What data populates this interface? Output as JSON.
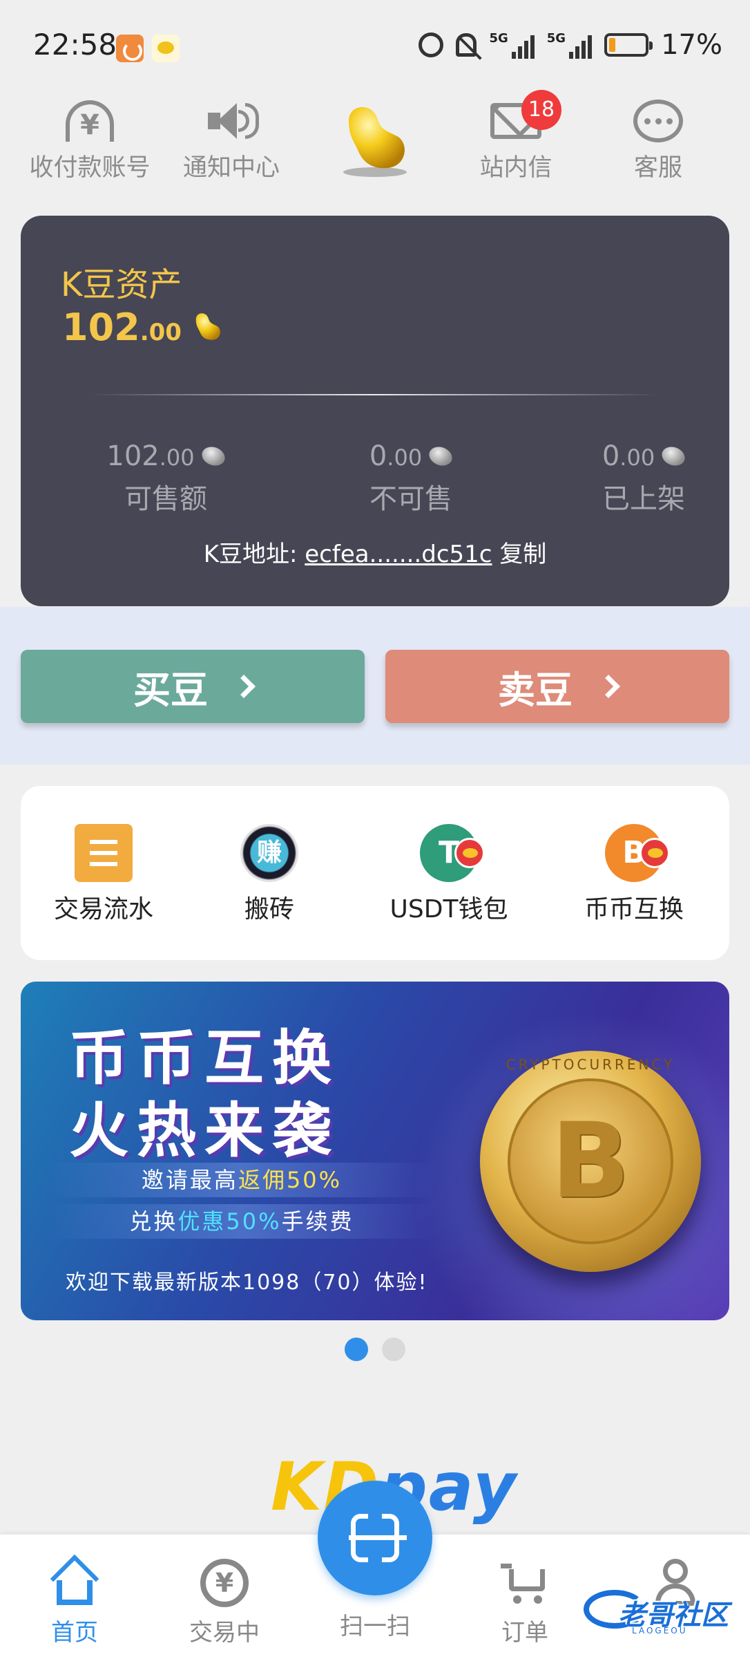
{
  "status_bar": {
    "time": "22:58",
    "network_label": "5G",
    "battery": "17%",
    "battery_level": 0.17
  },
  "top_menu": {
    "items": [
      {
        "label": "收付款账号",
        "icon": "payment-account-icon"
      },
      {
        "label": "通知中心",
        "icon": "speaker-icon"
      },
      {
        "label": "",
        "icon": "gold-bean-logo-icon"
      },
      {
        "label": "站内信",
        "icon": "mail-icon"
      },
      {
        "label": "客服",
        "icon": "chat-icon"
      }
    ],
    "unread_badge": "18"
  },
  "asset_card": {
    "title": "K豆资产",
    "amount_int": "102",
    "amount_dec": ".00",
    "stats": [
      {
        "int": "102",
        "dec": ".00",
        "label": "可售额"
      },
      {
        "int": "0",
        "dec": ".00",
        "label": "不可售"
      },
      {
        "int": "0",
        "dec": ".00",
        "label": "已上架"
      }
    ],
    "address_label": "K豆地址:",
    "address_value": "ecfea.......dc51c",
    "copy_label": "复制"
  },
  "trade": {
    "buy_label": "买豆",
    "sell_label": "卖豆"
  },
  "quick_tiles": [
    {
      "label": "交易流水",
      "icon": "transaction-list-icon"
    },
    {
      "label": "搬砖",
      "icon": "earn-icon",
      "glyph": "赚"
    },
    {
      "label": "USDT钱包",
      "icon": "usdt-wallet-icon",
      "glyph": "T"
    },
    {
      "label": "币币互换",
      "icon": "coin-swap-icon",
      "glyph": "B"
    }
  ],
  "banner": {
    "line1": "币币互换",
    "line2": "火热来袭",
    "strip1_prefix": "邀请最高",
    "strip1_highlight": "返佣50%",
    "strip2_prefix": "兑换",
    "strip2_highlight": "优惠50%",
    "strip2_suffix": "手续费",
    "footer": "欢迎下载最新版本1098（70）体验!",
    "coin_ring_text": "CRYPTOCURRENCY",
    "coin_glyph": "B",
    "pages": 2,
    "active_page": 1
  },
  "brand": {
    "kd": "KD",
    "pay": "pay"
  },
  "bottom_nav": {
    "items": [
      {
        "label": "首页",
        "active": true
      },
      {
        "label": "交易中",
        "active": false,
        "glyph": "¥"
      },
      {
        "label": "扫一扫",
        "active": false
      },
      {
        "label": "订单",
        "active": false
      },
      {
        "label": "",
        "active": false
      }
    ]
  },
  "watermark": {
    "text": "老哥社区",
    "sub": "LAOGEOU"
  },
  "colors": {
    "accent_blue": "#2f8fe8",
    "asset_card_bg": "#474654",
    "gold": "#f3c64b",
    "buy_green": "#6ba99b",
    "sell_red": "#de8b79",
    "badge_red": "#ef3b3b"
  }
}
